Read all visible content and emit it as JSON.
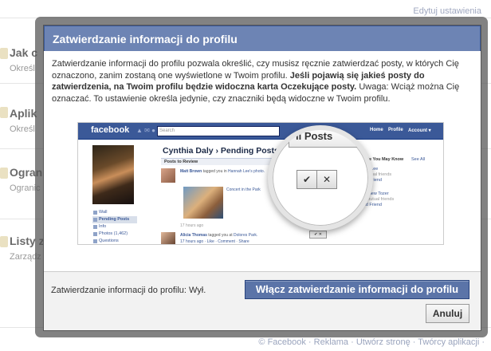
{
  "background": {
    "top_line": "Jak nawiązać połączenia",
    "top_line_sub": "Określ, czy możesz kontaktować się z osobami, które znasz.",
    "top_edit": "Edytuj ustawienia",
    "sections": [
      {
        "title": "Jak c",
        "sub": "Określ"
      },
      {
        "title": "Aplik",
        "sub": "Określ"
      },
      {
        "title": "Ogran",
        "sub": "Ogranic"
      },
      {
        "title": "Listy z",
        "sub": "Zarządz"
      }
    ],
    "footer_links": "© Facebook · Reklama · Utwórz stronę · Twórcy aplikacji ·"
  },
  "dialog": {
    "title": "Zatwierdzanie informacji do profilu",
    "intro": "Zatwierdzanie informacji do profilu pozwala określić, czy musisz ręcznie zatwierdzać posty, w których Cię oznaczono, zanim zostaną one wyświetlone w Twoim profilu.",
    "intro_bold": "Jeśli pojawią się jakieś posty do zatwierdzenia, na Twoim profilu będzie widoczna karta Oczekujące posty.",
    "intro_note": "Uwaga: Wciąż można Cię oznaczać. To ustawienie określa jedynie, czy znaczniki będą widoczne w Twoim profilu.",
    "status_label": "Zatwierdzanie informacji do profilu: Wył.",
    "enable_button": "Włącz zatwierdzanie informacji do profilu",
    "cancel_button": "Anuluj"
  },
  "preview": {
    "logo": "facebook",
    "search_placeholder": "Search",
    "nav_home": "Home",
    "nav_profile": "Profile",
    "nav_account": "Account ▾",
    "page_title": "Cynthia Daly › Pending Posts",
    "posts_to_review": "Posts to Review",
    "post1_author": "Matt Brown",
    "post1_text": "tagged you in",
    "post1_target": "Hannah Lee's photo.",
    "post1_photo_label": "Concert in the Park",
    "post1_time": "17 hours ago",
    "post2_author": "Alicia Thomas",
    "post2_text": "tagged you at",
    "post2_target": "Dolores Park.",
    "post2_meta": "17 hours ago · Like · Comment · Share",
    "left_nav": [
      "Wall",
      "Pending Posts",
      "Info",
      "Photos (1,462)",
      "Questions"
    ],
    "pymk_title": "People You May Know",
    "see_all": "See All",
    "pymk": [
      {
        "name": "Mike Lee",
        "mutual": "4 mutual friends",
        "action": "Add Friend"
      },
      {
        "name": "Matthew Tozer",
        "mutual": "29 mutual friends",
        "action": "Add Friend"
      }
    ],
    "magnifier_label": "ll Posts",
    "approve_icon": "check-icon",
    "hide_icon": "x-icon"
  },
  "colors": {
    "header_bg": "#6d84b4",
    "fb_blue": "#3b5998",
    "primary_button": "#5b74a8"
  }
}
